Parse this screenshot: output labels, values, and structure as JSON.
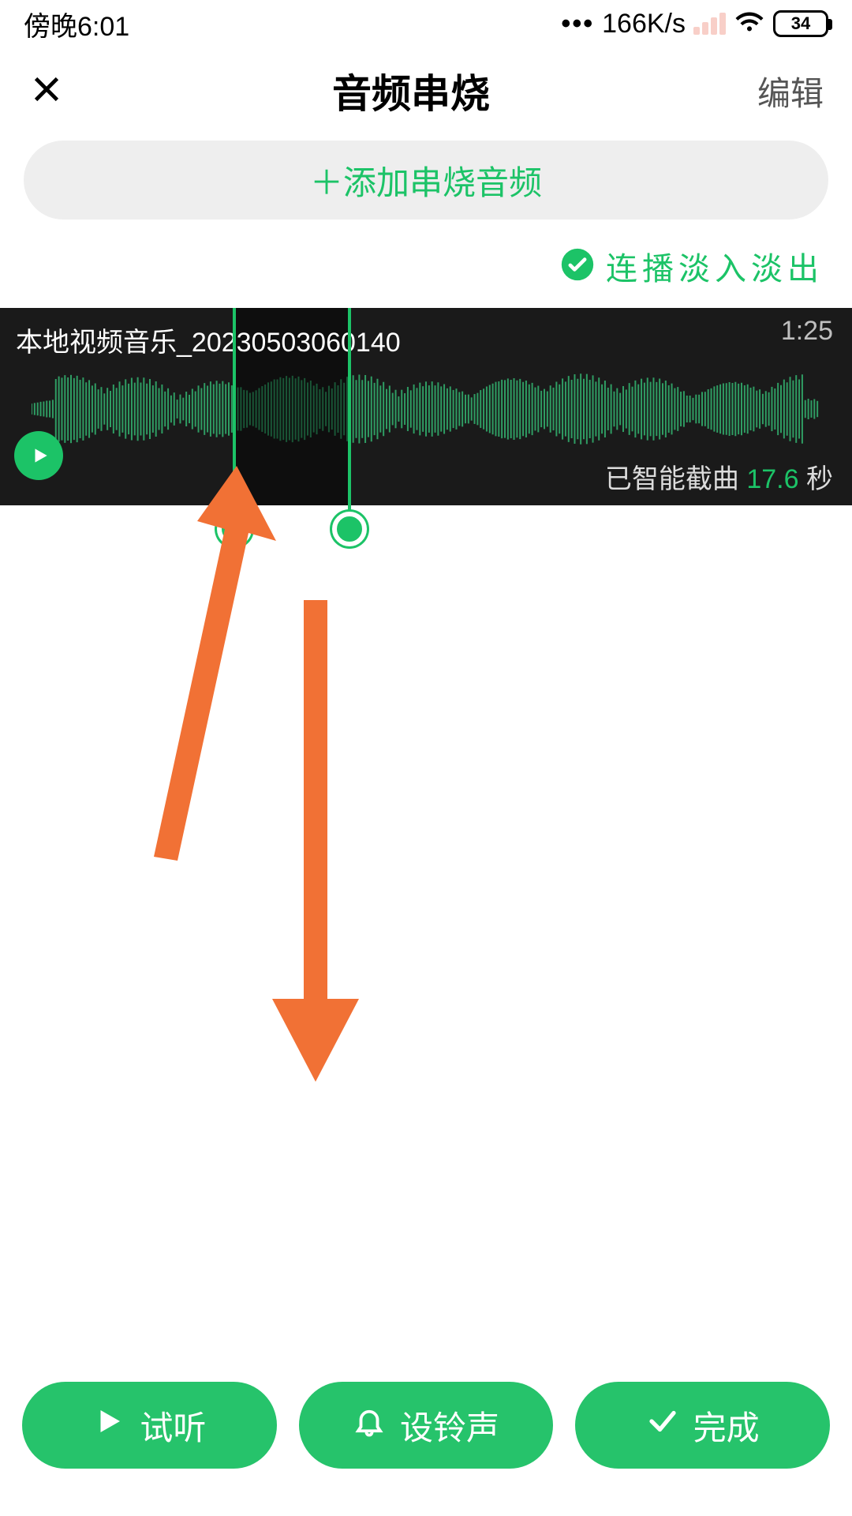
{
  "status": {
    "time": "傍晚6:01",
    "net_speed": "166K/s",
    "battery": "34"
  },
  "header": {
    "title": "音频串烧",
    "edit": "编辑"
  },
  "add_button": "＋添加串烧音频",
  "fade": {
    "label": "连播淡入淡出"
  },
  "track": {
    "name": "本地视频音乐_20230503060140",
    "duration": "1:25",
    "clip_prefix": "已智能截曲 ",
    "clip_seconds": "17.6",
    "clip_unit": " 秒",
    "selection": {
      "start_pct": 27.5,
      "end_pct": 41
    }
  },
  "buttons": {
    "preview": "试听",
    "ringtone": "设铃声",
    "done": "完成"
  },
  "colors": {
    "accent": "#1cc367",
    "arrow": "#f17135"
  }
}
